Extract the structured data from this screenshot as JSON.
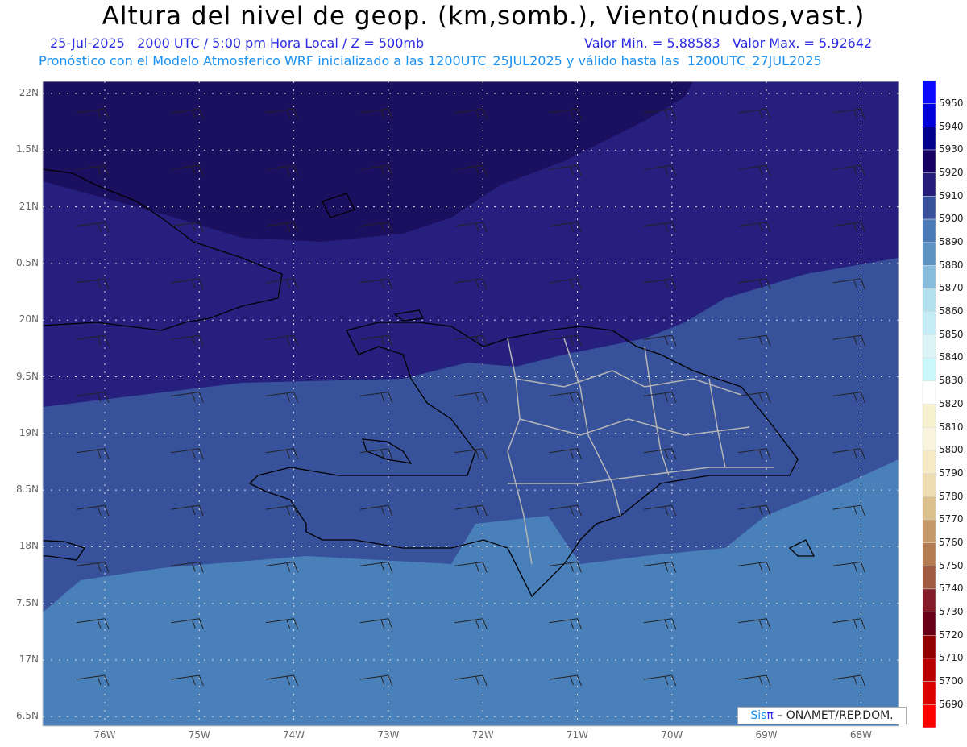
{
  "header": {
    "title": "Altura del nivel de geop. (km,somb.), Viento(nudos,vast.)",
    "datetime": "25-Jul-2025   2000 UTC / 5:00 pm Hora Local / Z = 500mb",
    "minmax": "Valor Min. = 5.88583   Valor Max. = 5.92642",
    "subtitle": "Pronóstico con el Modelo Atmosferico WRF inicializado a las 1200UTC_25JUL2025 y válido hasta las  1200UTC_27JUL2025"
  },
  "lat_labels": [
    "22N",
    "1.5N",
    "21N",
    "0.5N",
    "20N",
    "9.5N",
    "19N",
    "8.5N",
    "18N",
    "7.5N",
    "17N",
    "6.5N"
  ],
  "lon_labels": [
    "76W",
    "75W",
    "74W",
    "73W",
    "72W",
    "71W",
    "70W",
    "69W",
    "68W"
  ],
  "colorbar": {
    "labels": [
      "5950",
      "5940",
      "5930",
      "5920",
      "5910",
      "5900",
      "5890",
      "5880",
      "5870",
      "5860",
      "5850",
      "5840",
      "5830",
      "5820",
      "5810",
      "5800",
      "5790",
      "5780",
      "5770",
      "5760",
      "5750",
      "5740",
      "5730",
      "5720",
      "5710",
      "5700",
      "5690"
    ],
    "colors": [
      "#0a0aff",
      "#0000d8",
      "#00008c",
      "#160062",
      "#241d7a",
      "#37519a",
      "#4a7bb8",
      "#5b93c5",
      "#88bcdc",
      "#b2e0ec",
      "#c4ecf4",
      "#dcf4f8",
      "#cbf8fb",
      "#ffffff",
      "#f7f0cc",
      "#faf3de",
      "#f4eac4",
      "#ecdcb0",
      "#dcc08c",
      "#c69868",
      "#b47c50",
      "#a05a40",
      "#841c2a",
      "#6a0018",
      "#900000",
      "#b80000",
      "#dc0000",
      "#ff0000"
    ]
  },
  "credit": {
    "sis": "Sis",
    "pi": "π",
    "rest": " – ONAMET/REP.DOM."
  }
}
